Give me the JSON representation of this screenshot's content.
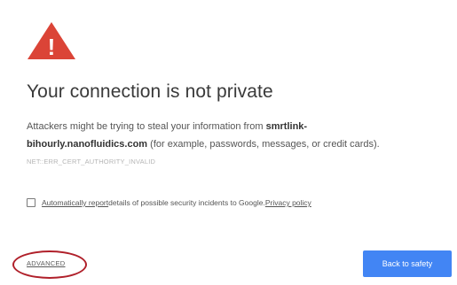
{
  "warning": {
    "icon": "warning-triangle-icon",
    "color": "#db4437",
    "glyph": "!"
  },
  "heading": "Your connection is not private",
  "message": {
    "prefix": "Attackers might be trying to steal your information from ",
    "host_line1": "smrtlink-",
    "host_line2": "bihourly.nanofluidics.com",
    "suffix": " (for example, passwords, messages, or credit cards)."
  },
  "error_code": "NET::ERR_CERT_AUTHORITY_INVALID",
  "report": {
    "checked": false,
    "link_text": "Automatically report",
    "text": " details of possible security incidents to Google. ",
    "privacy_link": "Privacy policy"
  },
  "advanced": {
    "label": "ADVANCED",
    "annotation_color": "#b0202a"
  },
  "back_button": {
    "label": "Back to safety",
    "color": "#4285f4"
  }
}
